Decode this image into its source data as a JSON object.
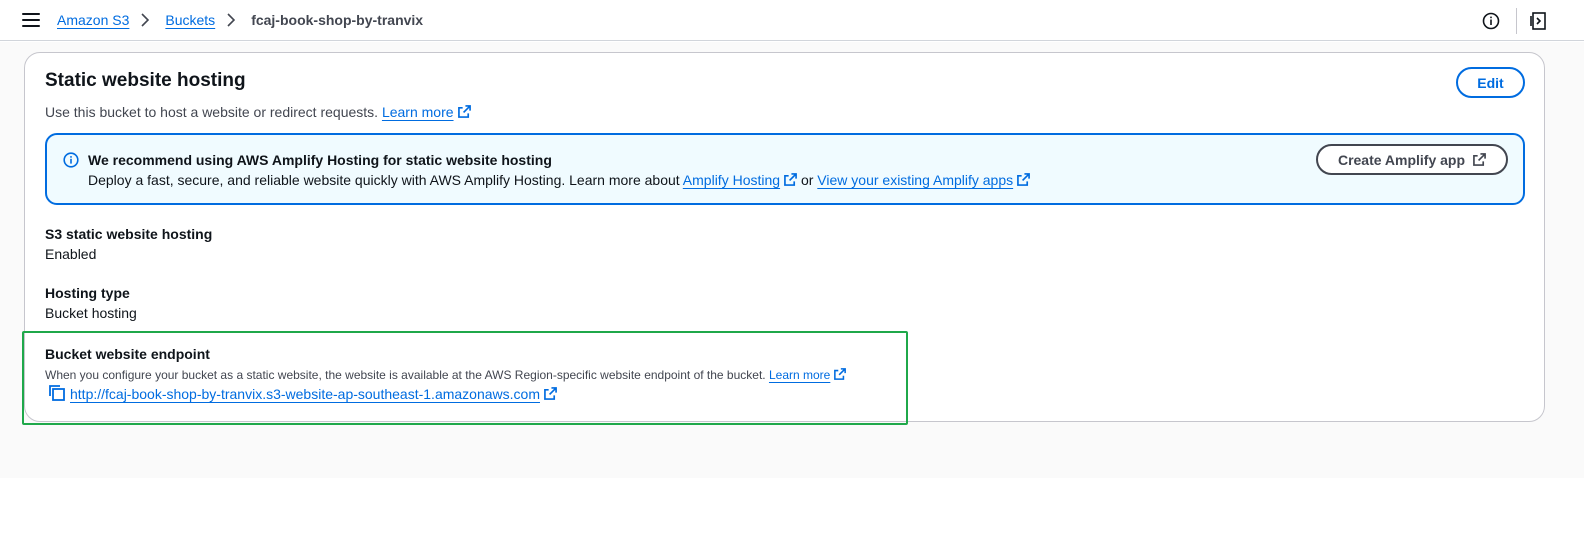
{
  "topbar": {
    "breadcrumbs": [
      "Amazon S3",
      "Buckets"
    ],
    "current": "fcaj-book-shop-by-tranvix",
    "icons": {
      "menu": "hamburger-menu-icon",
      "info": "info-icon",
      "panel": "split-panel-icon"
    }
  },
  "card": {
    "title": "Static website hosting",
    "description": "Use this bucket to host a website or redirect requests.",
    "learn_more": "Learn more",
    "edit_label": "Edit"
  },
  "alert": {
    "title": "We recommend using AWS Amplify Hosting for static website hosting",
    "body_prefix": "Deploy a fast, secure, and reliable website quickly with AWS Amplify Hosting. Learn more about",
    "link1": "Amplify Hosting",
    "or_text": "or",
    "link2": "View your existing Amplify apps",
    "button_label": "Create Amplify app",
    "accent_color": "#006ce0"
  },
  "details": {
    "hosting_label": "S3 static website hosting",
    "hosting_value": "Enabled",
    "type_label": "Hosting type",
    "type_value": "Bucket hosting",
    "endpoint_label": "Bucket website endpoint",
    "endpoint_desc": "When you configure your bucket as a static website, the website is available at the AWS Region-specific website endpoint of the bucket.",
    "endpoint_learn_more": "Learn more",
    "endpoint_url": "http://fcaj-book-shop-by-tranvix.s3-website-ap-southeast-1.amazonaws.com",
    "highlight_color": "#1fa84a"
  }
}
